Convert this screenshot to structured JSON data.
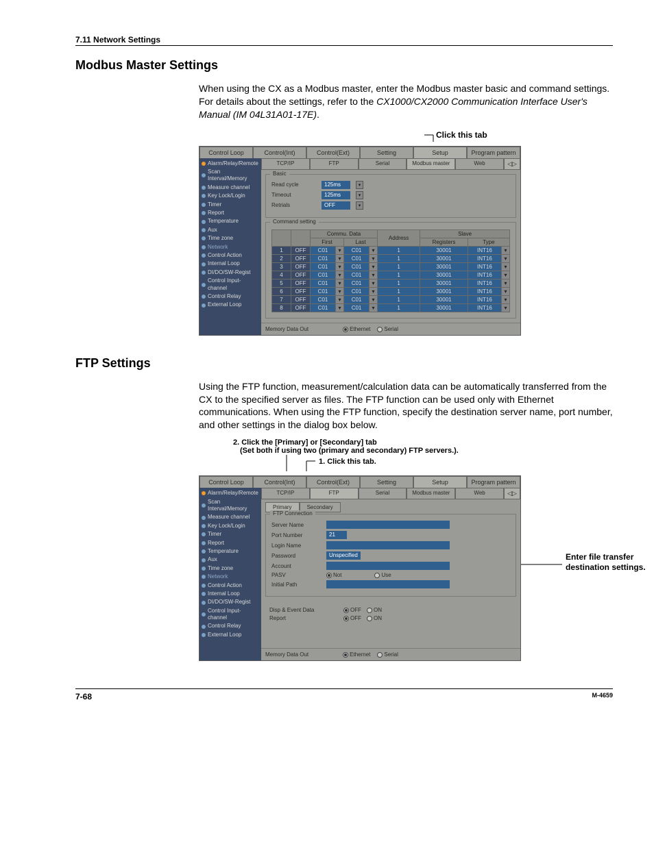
{
  "page": {
    "section_header": "7.11  Network Settings",
    "page_number": "7-68",
    "doc_id": "M-4659"
  },
  "modbus": {
    "heading": "Modbus Master Settings",
    "body_before": "When using the CX as a Modbus master, enter the Modbus master basic and command settings.  For details about the settings, refer to the ",
    "body_italic": "CX1000/CX2000 Communication Interface User's Manual (IM 04L31A01-17E)",
    "body_after": ".",
    "annot_click_tab": "Click this tab"
  },
  "ftp": {
    "heading": "FTP Settings",
    "body": "Using the FTP function, measurement/calculation data can be automatically transferred from the CX to the specified server as files.  The FTP function can be used only with Ethernet communications.  When using the FTP function, specify the destination server name, port number, and other settings in the dialog box below.",
    "annot2": "2. Click the [Primary] or [Secondary] tab",
    "annot2b": "(Set both if using two (primary and secondary) FTP servers.).",
    "annot1": "1. Click this tab.",
    "side_annot": "Enter file transfer destination settings."
  },
  "common": {
    "top_tabs": [
      "Control Loop",
      "Control(Int)",
      "Control(Ext)",
      "Setting",
      "Setup",
      "Program pattern"
    ],
    "sub_tabs": [
      "TCP/IP",
      "FTP",
      "Serial",
      "Modbus master",
      "Web"
    ],
    "nav_left": "◁",
    "nav_right": "▷",
    "sidebar": [
      {
        "label": "Alarm/Relay/Remote",
        "orange": true
      },
      {
        "label": "Scan Interval/Memory",
        "orange": false
      },
      {
        "label": "Measure channel",
        "orange": false
      },
      {
        "label": "Key Lock/Login",
        "orange": false
      },
      {
        "label": "Timer",
        "orange": false
      },
      {
        "label": "Report",
        "orange": false
      },
      {
        "label": "Temperature",
        "orange": false
      },
      {
        "label": "Aux",
        "orange": false
      },
      {
        "label": "Time zone",
        "orange": false
      },
      {
        "label": "Network",
        "orange": false,
        "highlight": true
      },
      {
        "label": "Control Action",
        "orange": false
      },
      {
        "label": "Internal Loop",
        "orange": false
      },
      {
        "label": "DI/DO/SW-Regist",
        "orange": false
      },
      {
        "label": "Control Input-channel",
        "orange": false
      },
      {
        "label": "Control Relay",
        "orange": false
      },
      {
        "label": "External Loop",
        "orange": false
      }
    ],
    "footer_label": "Memory Data Out",
    "footer_opt1": "Ethernet",
    "footer_opt2": "Serial"
  },
  "modbus_form": {
    "group_basic": "Basic",
    "read_cycle_label": "Read cycle",
    "read_cycle_value": "125ms",
    "timeout_label": "Timeout",
    "timeout_value": "125ms",
    "retrials_label": "Retrials",
    "retrials_value": "OFF",
    "group_command": "Command setting",
    "thead_blank": "",
    "thead_commu": "Commu. Data",
    "thead_first": "First",
    "thead_last": "Last",
    "thead_addr": "Address",
    "thead_slave": "Slave",
    "thead_reg": "Registers",
    "thead_type": "Type",
    "rows": [
      {
        "n": "1",
        "on": "OFF",
        "first": "C01",
        "last": "C01",
        "addr": "1",
        "reg": "30001",
        "type": "INT16"
      },
      {
        "n": "2",
        "on": "OFF",
        "first": "C01",
        "last": "C01",
        "addr": "1",
        "reg": "30001",
        "type": "INT16"
      },
      {
        "n": "3",
        "on": "OFF",
        "first": "C01",
        "last": "C01",
        "addr": "1",
        "reg": "30001",
        "type": "INT16"
      },
      {
        "n": "4",
        "on": "OFF",
        "first": "C01",
        "last": "C01",
        "addr": "1",
        "reg": "30001",
        "type": "INT16"
      },
      {
        "n": "5",
        "on": "OFF",
        "first": "C01",
        "last": "C01",
        "addr": "1",
        "reg": "30001",
        "type": "INT16"
      },
      {
        "n": "6",
        "on": "OFF",
        "first": "C01",
        "last": "C01",
        "addr": "1",
        "reg": "30001",
        "type": "INT16"
      },
      {
        "n": "7",
        "on": "OFF",
        "first": "C01",
        "last": "C01",
        "addr": "1",
        "reg": "30001",
        "type": "INT16"
      },
      {
        "n": "8",
        "on": "OFF",
        "first": "C01",
        "last": "C01",
        "addr": "1",
        "reg": "30001",
        "type": "INT16"
      }
    ]
  },
  "ftp_form": {
    "subsub": [
      "Primary",
      "Secondary"
    ],
    "group_conn": "FTP Connection",
    "server_name_label": "Server Name",
    "server_name_value": "",
    "port_label": "Port Number",
    "port_value": "21",
    "login_label": "Login Name",
    "login_value": "",
    "password_label": "Password",
    "password_value": "Unspecified",
    "account_label": "Account",
    "account_value": "",
    "pasv_label": "PASV",
    "pasv_not": "Not",
    "pasv_use": "Use",
    "initial_path_label": "Initial Path",
    "initial_path_value": "",
    "disp_event_label": "Disp & Event Data",
    "report_label": "Report",
    "off_label": "OFF",
    "on_label": "ON"
  }
}
